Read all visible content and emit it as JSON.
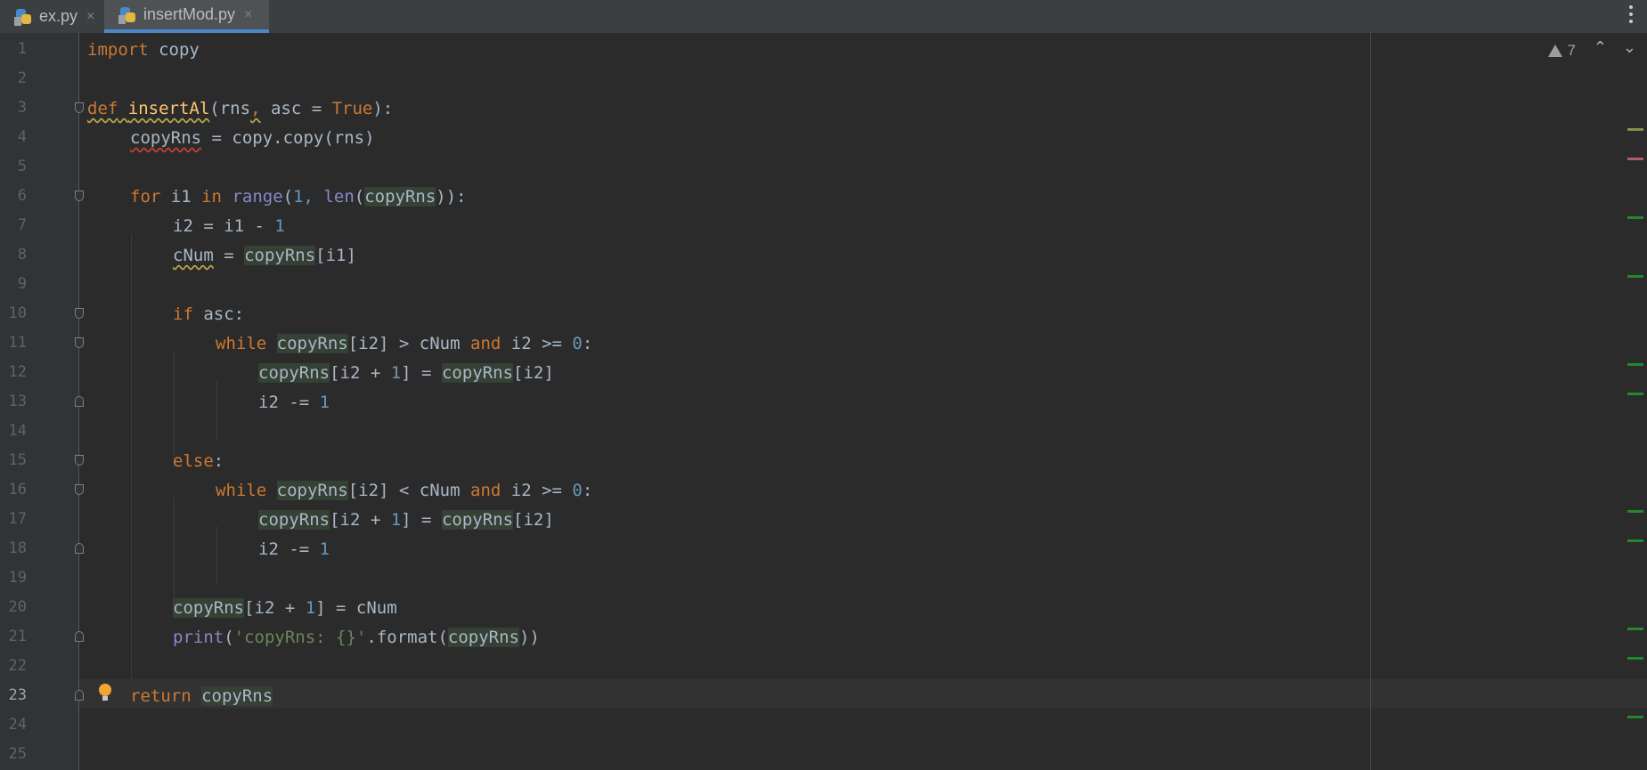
{
  "tabs": [
    {
      "label": "ex.py",
      "close": "×"
    },
    {
      "label": "insertMod.py",
      "close": "×"
    }
  ],
  "inspection": {
    "warning_count": "7",
    "up": "⌃",
    "down": "⌄"
  },
  "line_numbers": [
    "1",
    "2",
    "3",
    "4",
    "5",
    "6",
    "7",
    "8",
    "9",
    "10",
    "11",
    "12",
    "13",
    "14",
    "15",
    "16",
    "17",
    "18",
    "19",
    "20",
    "21",
    "22",
    "23",
    "24",
    "25"
  ],
  "code": {
    "l1": {
      "kw": "import",
      "rest": " copy"
    },
    "l3": {
      "def": "def",
      "sp": " ",
      "name": "insertAl",
      "p1": "(rns",
      "comma": ",",
      "p2": " asc = ",
      "true": "True",
      "end": "):"
    },
    "l4": {
      "var": "copyRns",
      "rest": " = copy.copy(rns)"
    },
    "l6": {
      "for": "for",
      "a": " i1 ",
      "in": "in",
      "sp": " ",
      "range": "range",
      "b": "(",
      "one": "1,",
      "c": " ",
      "len": "len",
      "d": "(",
      "var": "copyRns",
      "e": ")):"
    },
    "l7": {
      "a": "i2 = i1 - ",
      "num": "1"
    },
    "l8": {
      "var": "cNum",
      "a": " = ",
      "ref": "copyRns",
      "b": "[i1]"
    },
    "l10": {
      "kw": "if",
      "rest": " asc:"
    },
    "l11": {
      "kw": "while",
      "sp": " ",
      "ref": "copyRns",
      "a": "[i2] > cNum ",
      "and": "and",
      "b": " i2 >= ",
      "zero": "0",
      "c": ":"
    },
    "l12": {
      "ref1": "copyRns",
      "a": "[i2 + ",
      "num": "1",
      "b": "] = ",
      "ref2": "copyRns",
      "c": "[i2]"
    },
    "l13": {
      "a": "i2 -= ",
      "num": "1"
    },
    "l15": {
      "kw": "else",
      "c": ":"
    },
    "l16": {
      "kw": "while",
      "sp": " ",
      "ref": "copyRns",
      "a": "[i2] < cNum ",
      "and": "and",
      "b": " i2 >= ",
      "zero": "0",
      "c": ":"
    },
    "l17": {
      "ref1": "copyRns",
      "a": "[i2 + ",
      "num": "1",
      "b": "] = ",
      "ref2": "copyRns",
      "c": "[i2]"
    },
    "l18": {
      "a": "i2 -= ",
      "num": "1"
    },
    "l20": {
      "ref": "copyRns",
      "a": "[i2 + ",
      "num": "1",
      "b": "] = cNum"
    },
    "l21": {
      "print": "print",
      "a": "(",
      "str": "'copyRns: {}'",
      "b": ".format(",
      "ref": "copyRns",
      "c": "))"
    },
    "l23": {
      "kw": "return",
      "sp": " ",
      "ref": "copyRns"
    }
  },
  "colors": {
    "keyword": "#cc7832",
    "function": "#ffc66d",
    "number": "#6897bb",
    "builtin": "#8888c6",
    "string": "#6a8759",
    "text": "#a9b7c6",
    "accent": "#4a88c7"
  }
}
